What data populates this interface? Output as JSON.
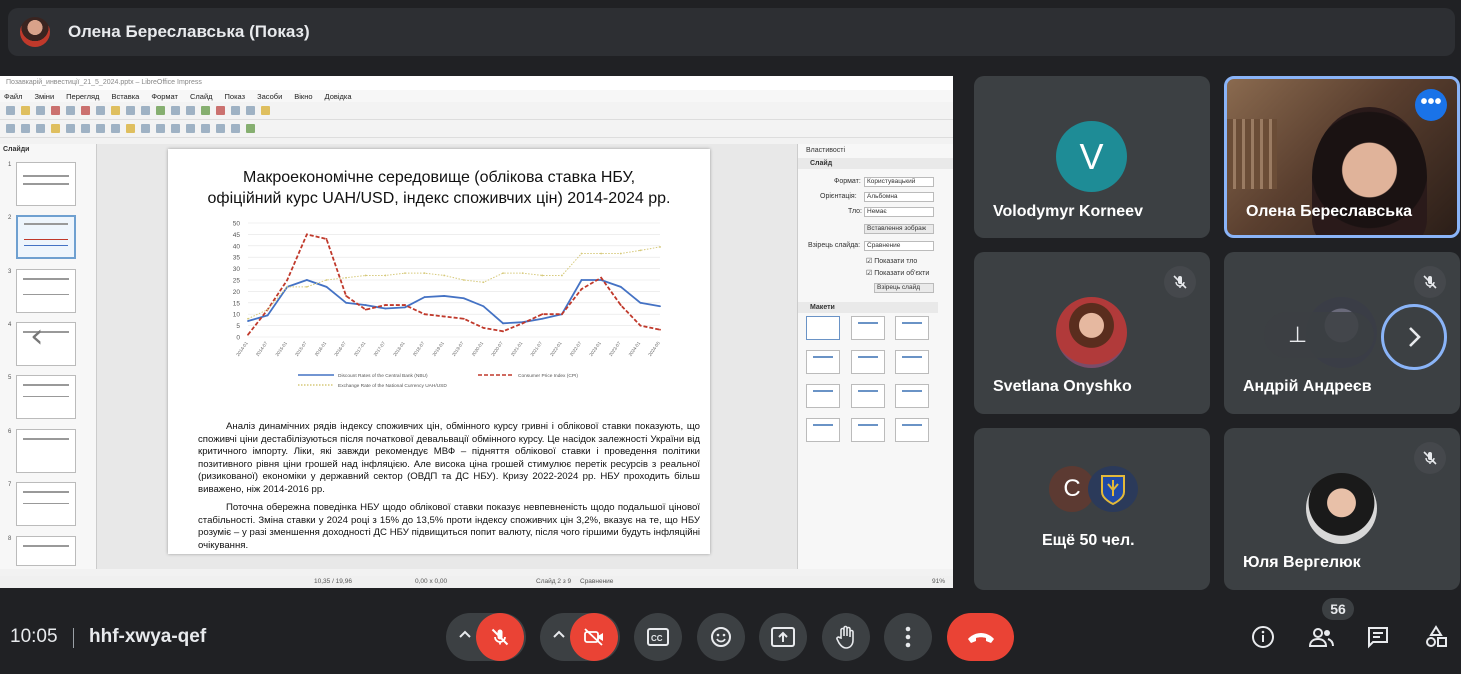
{
  "presenter": {
    "name": "Олена Береславська (Показ)"
  },
  "impress": {
    "window_title": "Позавкарій_инвестиції_21_5_2024.pptx – LibreOffice Impress",
    "menu": [
      "Файл",
      "Зміни",
      "Перегляд",
      "Вставка",
      "Формат",
      "Слайд",
      "Показ",
      "Засоби",
      "Вікно",
      "Довідка"
    ],
    "slides_pane_title": "Слайди",
    "slide_numbers": [
      "1",
      "2",
      "3",
      "4",
      "5",
      "6",
      "7",
      "8"
    ],
    "slide": {
      "title_line1": "Макроекономічне середовище (облікова ставка НБУ,",
      "title_line2": "офіційний курс UAH/USD, індекс споживчих цін) 2014-2024 рр.",
      "paragraph1": "Аналіз динамічних рядів індексу споживчих цін, обмінного курсу гривні і облікової ставки показують, що споживчі ціни дестабілізуються після початкової девальвації обмінного курсу. Це насідок залежності України від критичного імпорту. Ліки, які завжди рекомендує МВФ – підняття облікової ставки і проведення політики позитивного рівня ціни грошей над інфляцією. Але висока ціна грошей стимулює перетік ресурсів з реальної (ризикованої) економіки у державний сектор (ОВДП та ДС НБУ). Кризу 2022-2024 рр. НБУ проходить більш виважено, ніж 2014-2016 рр.",
      "paragraph2": "Поточна обережна поведінка НБУ щодо облікової ставки показує невпевненість щодо подальшої цінової стабільності. Зміна ставки у 2024 році з 15% до 13,5% проти індексу споживчих цін 3,2%, вказує на те, що НБУ розуміє – у разі зменшення доходності ДС НБУ підвищиться попит валюту, після чого гіршими будуть інфляційні очікування."
    },
    "properties": {
      "title": "Властивості",
      "section_slide": "Слайд",
      "format_label": "Формат:",
      "format_value": "Користувацький",
      "orientation_label": "Орієнтація:",
      "orientation_value": "Альбомна",
      "background_label": "Тло:",
      "background_value": "Немає",
      "insert_image": "Вставлення зображ",
      "master_label": "Взірець слайда:",
      "master_value": "Сравнение",
      "show_bg": "Показати тло",
      "show_objects": "Показати об'єкти",
      "master_slides_btn": "Взірець слайд",
      "section_layouts": "Макети"
    },
    "status": {
      "position": "10,35 / 19,96",
      "size": "0,00 x 0,00",
      "slide": "Слайд 2 з 9",
      "layout": "Сравнение",
      "zoom": "91%"
    }
  },
  "chart_data": {
    "type": "line",
    "x": [
      "2014-01",
      "2014-07",
      "2015-01",
      "2015-07",
      "2016-01",
      "2016-07",
      "2017-01",
      "2017-07",
      "2018-01",
      "2018-07",
      "2019-01",
      "2019-07",
      "2020-01",
      "2020-07",
      "2021-01",
      "2021-07",
      "2022-01",
      "2022-07",
      "2023-01",
      "2023-07",
      "2024-01",
      "2024-05"
    ],
    "ylim": [
      0,
      50
    ],
    "yticks": [
      "0",
      "5",
      "10",
      "15",
      "20",
      "25",
      "30",
      "35",
      "40",
      "45",
      "50"
    ],
    "series": [
      {
        "name": "Discount Rates of the Central Bank (NBU)",
        "color": "#4472c4",
        "dash": "solid",
        "values": [
          7,
          9.5,
          22,
          25,
          22,
          15,
          14,
          12.5,
          13,
          17.5,
          18,
          17,
          13.5,
          6,
          6.5,
          8,
          10,
          25,
          25,
          22,
          15,
          13.5
        ]
      },
      {
        "name": "Consumer Price Index (CPI)",
        "color": "#c0392b",
        "dash": "dashed",
        "values": [
          1,
          12,
          25,
          45,
          43,
          18,
          12,
          14,
          14,
          10,
          9,
          8,
          4,
          2.5,
          6,
          10,
          10,
          21,
          26,
          14,
          5,
          3.2
        ]
      },
      {
        "name": "Exchange Rate of the National Currency UAH/USD",
        "color": "#d6c97a",
        "dash": "dotted",
        "values": [
          8,
          12,
          22,
          22,
          25,
          26,
          27,
          27,
          28,
          28,
          27,
          25,
          24,
          28,
          28,
          27,
          27,
          36.6,
          36.6,
          36.6,
          38,
          39.5
        ]
      }
    ]
  },
  "meet": {
    "participants": [
      {
        "name": "Volodymyr Korneev",
        "initial": "V",
        "color": "#1e8c96"
      },
      {
        "name": "Олена Береславська"
      },
      {
        "name": "Svetlana Onyshko"
      },
      {
        "name": "Андрій Андреєв"
      },
      {
        "name": "Ещё 50 чел.",
        "initial": "C",
        "color": "#5c3a32"
      },
      {
        "name": "Юля Вергелюк"
      }
    ],
    "pin_glyph": "⊥",
    "time": "10:05",
    "meeting_code": "hhf-xwya-qef",
    "participant_count": "56",
    "colors": {
      "end_call": "#ea4335",
      "muted": "#ea4335",
      "active_outline": "#8ab4f8"
    }
  }
}
